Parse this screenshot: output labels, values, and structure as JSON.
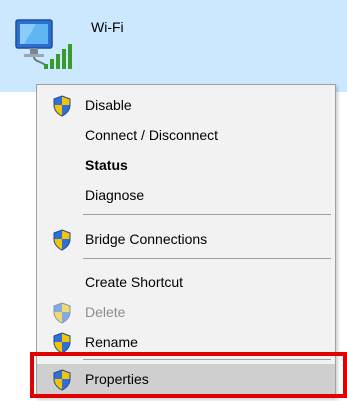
{
  "adapter": {
    "name": "Wi-Fi",
    "icon": "network-wifi-icon"
  },
  "menu": {
    "items": [
      {
        "label": "Disable",
        "icon": "uac-shield-icon",
        "style": "normal"
      },
      {
        "label": "Connect / Disconnect",
        "icon": "",
        "style": "normal"
      },
      {
        "label": "Status",
        "icon": "",
        "style": "bold"
      },
      {
        "label": "Diagnose",
        "icon": "",
        "style": "normal"
      },
      {
        "label": "Bridge Connections",
        "icon": "uac-shield-icon",
        "style": "normal"
      },
      {
        "label": "Create Shortcut",
        "icon": "",
        "style": "normal"
      },
      {
        "label": "Delete",
        "icon": "uac-shield-icon",
        "style": "disabled"
      },
      {
        "label": "Rename",
        "icon": "uac-shield-icon",
        "style": "normal"
      },
      {
        "label": "Properties",
        "icon": "uac-shield-icon",
        "style": "highlighted"
      }
    ]
  },
  "colors": {
    "tile_selected": "#cce8ff",
    "menu_background": "#f2f2f2",
    "highlight_box": "#e00000",
    "shield_blue": "#2f6fd6",
    "shield_yellow": "#f5c400"
  }
}
